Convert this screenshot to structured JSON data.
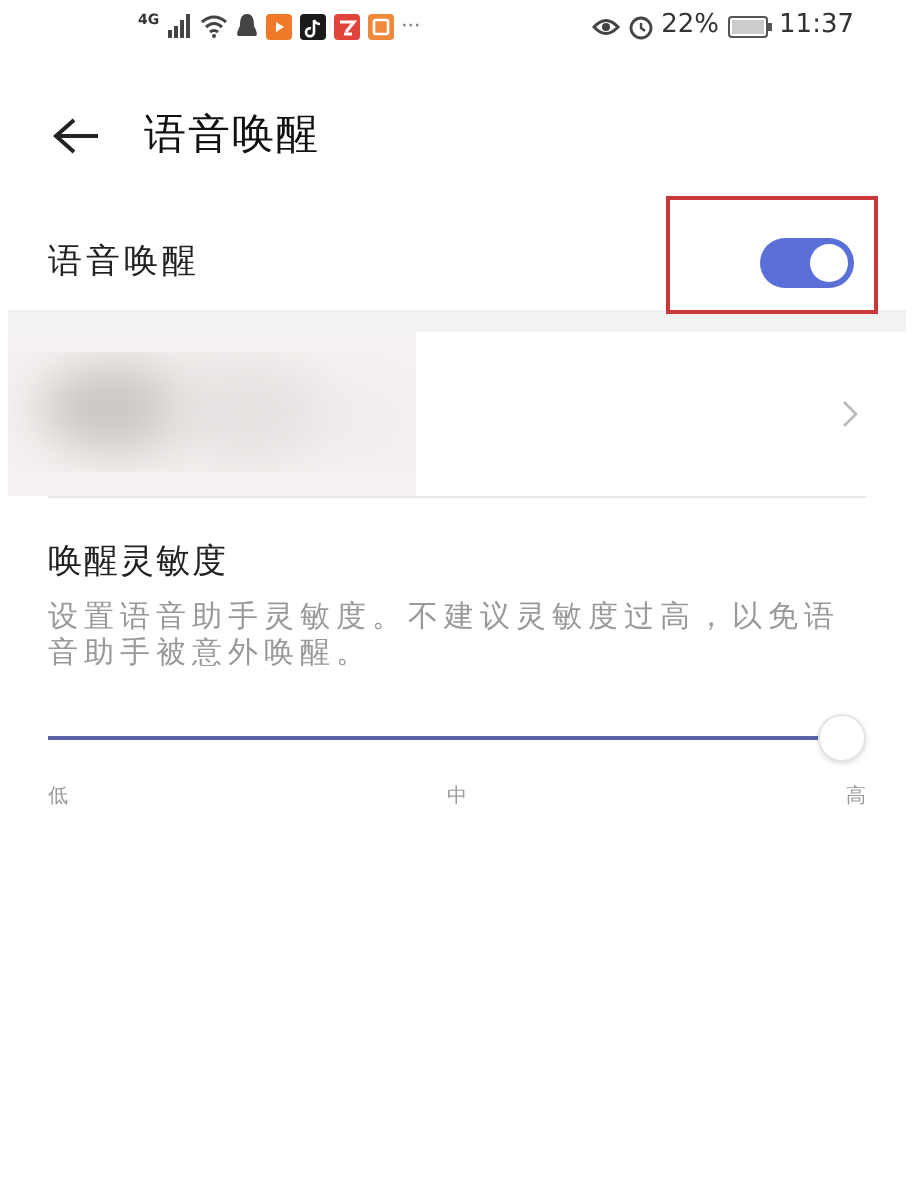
{
  "status_bar": {
    "network": "4G",
    "more": "···",
    "battery_percent": "22%",
    "time": "11:37"
  },
  "header": {
    "title": "语音唤醒"
  },
  "wake_toggle": {
    "label": "语音唤醒",
    "on": true,
    "highlighted": true
  },
  "sensitivity": {
    "title": "唤醒灵敏度",
    "description": "设置语音助手灵敏度。不建议灵敏度过高，以免语音助手被意外唤醒。",
    "level": 1,
    "labels": [
      "低",
      "中",
      "高"
    ]
  }
}
